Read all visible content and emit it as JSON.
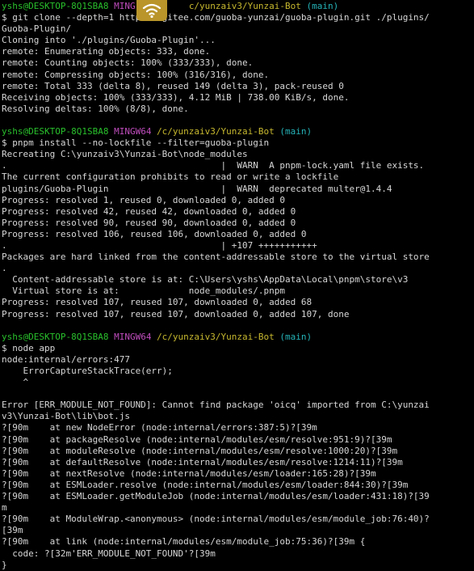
{
  "colors": {
    "background": "#000000",
    "text": "#d7d7d7",
    "user": "#29c02c",
    "host": "#c04dbd",
    "path": "#c7b82f",
    "branch": "#25b3b8",
    "overlay": "#b9952a"
  },
  "overlay_icon": "wifi-icon",
  "lines": [
    [
      [
        "user",
        "yshs@DESKTOP-8Q1SBA8 "
      ],
      [
        "host",
        "MING"
      ],
      [
        "plain",
        "          "
      ],
      [
        "path",
        "c/yunzaiv3/Yunzai-Bot "
      ],
      [
        "branch",
        "(main)"
      ]
    ],
    [
      [
        "plain",
        "$ git clone --depth=1 https://gitee.com/guoba-yunzai/guoba-plugin.git ./plugins/"
      ]
    ],
    [
      [
        "plain",
        "Guoba-Plugin/"
      ]
    ],
    [
      [
        "plain",
        "Cloning into './plugins/Guoba-Plugin'..."
      ]
    ],
    [
      [
        "plain",
        "remote: Enumerating objects: 333, done."
      ]
    ],
    [
      [
        "plain",
        "remote: Counting objects: 100% (333/333), done."
      ]
    ],
    [
      [
        "plain",
        "remote: Compressing objects: 100% (316/316), done."
      ]
    ],
    [
      [
        "plain",
        "remote: Total 333 (delta 8), reused 149 (delta 3), pack-reused 0"
      ]
    ],
    [
      [
        "plain",
        "Receiving objects: 100% (333/333), 4.12 MiB | 738.00 KiB/s, done."
      ]
    ],
    [
      [
        "plain",
        "Resolving deltas: 100% (8/8), done."
      ]
    ],
    [
      [
        "plain",
        ""
      ]
    ],
    [
      [
        "user",
        "yshs@DESKTOP-8Q1SBA8 "
      ],
      [
        "host",
        "MINGW64 "
      ],
      [
        "path",
        "/c/yunzaiv3/Yunzai-Bot "
      ],
      [
        "branch",
        "(main)"
      ]
    ],
    [
      [
        "plain",
        "$ pnpm install --no-lockfile --filter=guoba-plugin"
      ]
    ],
    [
      [
        "plain",
        "Recreating C:\\yunzaiv3\\Yunzai-Bot\\node_modules"
      ]
    ],
    [
      [
        "plain",
        ".                                        |  WARN  A pnpm-lock.yaml file exists."
      ]
    ],
    [
      [
        "plain",
        "The current configuration prohibits to read or write a lockfile"
      ]
    ],
    [
      [
        "plain",
        "plugins/Guoba-Plugin                     |  WARN  deprecated multer@1.4.4"
      ]
    ],
    [
      [
        "plain",
        "Progress: resolved 1, reused 0, downloaded 0, added 0"
      ]
    ],
    [
      [
        "plain",
        "Progress: resolved 42, reused 42, downloaded 0, added 0"
      ]
    ],
    [
      [
        "plain",
        "Progress: resolved 90, reused 90, downloaded 0, added 0"
      ]
    ],
    [
      [
        "plain",
        "Progress: resolved 106, reused 106, downloaded 0, added 0"
      ]
    ],
    [
      [
        "plain",
        ".                                        | +107 +++++++++++"
      ]
    ],
    [
      [
        "plain",
        "Packages are hard linked from the content-addressable store to the virtual store"
      ]
    ],
    [
      [
        "plain",
        "."
      ]
    ],
    [
      [
        "plain",
        "  Content-addressable store is at: C:\\Users\\yshs\\AppData\\Local\\pnpm\\store\\v3"
      ]
    ],
    [
      [
        "plain",
        "  Virtual store is at:             node_modules/.pnpm"
      ]
    ],
    [
      [
        "plain",
        "Progress: resolved 107, reused 107, downloaded 0, added 68"
      ]
    ],
    [
      [
        "plain",
        "Progress: resolved 107, reused 107, downloaded 0, added 107, done"
      ]
    ],
    [
      [
        "plain",
        ""
      ]
    ],
    [
      [
        "user",
        "yshs@DESKTOP-8Q1SBA8 "
      ],
      [
        "host",
        "MINGW64 "
      ],
      [
        "path",
        "/c/yunzaiv3/Yunzai-Bot "
      ],
      [
        "branch",
        "(main)"
      ]
    ],
    [
      [
        "plain",
        "$ node app"
      ]
    ],
    [
      [
        "plain",
        "node:internal/errors:477"
      ]
    ],
    [
      [
        "plain",
        "    ErrorCaptureStackTrace(err);"
      ]
    ],
    [
      [
        "plain",
        "    ^"
      ]
    ],
    [
      [
        "plain",
        ""
      ]
    ],
    [
      [
        "plain",
        "Error [ERR_MODULE_NOT_FOUND]: Cannot find package 'oicq' imported from C:\\yunzai"
      ]
    ],
    [
      [
        "plain",
        "v3\\Yunzai-Bot\\lib\\bot.js"
      ]
    ],
    [
      [
        "plain",
        "?[90m    at new NodeError (node:internal/errors:387:5)?[39m"
      ]
    ],
    [
      [
        "plain",
        "?[90m    at packageResolve (node:internal/modules/esm/resolve:951:9)?[39m"
      ]
    ],
    [
      [
        "plain",
        "?[90m    at moduleResolve (node:internal/modules/esm/resolve:1000:20)?[39m"
      ]
    ],
    [
      [
        "plain",
        "?[90m    at defaultResolve (node:internal/modules/esm/resolve:1214:11)?[39m"
      ]
    ],
    [
      [
        "plain",
        "?[90m    at nextResolve (node:internal/modules/esm/loader:165:28)?[39m"
      ]
    ],
    [
      [
        "plain",
        "?[90m    at ESMLoader.resolve (node:internal/modules/esm/loader:844:30)?[39m"
      ]
    ],
    [
      [
        "plain",
        "?[90m    at ESMLoader.getModuleJob (node:internal/modules/esm/loader:431:18)?[39"
      ]
    ],
    [
      [
        "plain",
        "m"
      ]
    ],
    [
      [
        "plain",
        "?[90m    at ModuleWrap.<anonymous> (node:internal/modules/esm/module_job:76:40)?"
      ]
    ],
    [
      [
        "plain",
        "[39m"
      ]
    ],
    [
      [
        "plain",
        "?[90m    at link (node:internal/modules/esm/module_job:75:36)?[39m {"
      ]
    ],
    [
      [
        "plain",
        "  code: ?[32m'ERR_MODULE_NOT_FOUND'?[39m"
      ]
    ],
    [
      [
        "plain",
        "}"
      ]
    ]
  ]
}
